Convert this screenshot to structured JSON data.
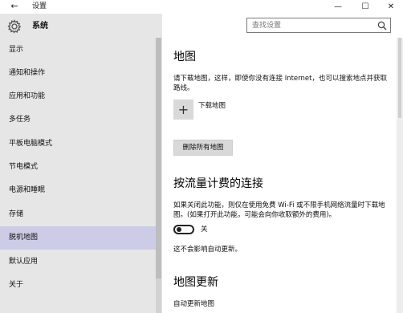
{
  "titlebar": {
    "title": "设置",
    "back_icon": "arrow-left-icon",
    "minimize_glyph": "—",
    "maximize_glyph": "☐",
    "close_glyph": "✕"
  },
  "sidebar": {
    "header": "系统",
    "header_icon": "gear-icon",
    "items": [
      {
        "label": "显示"
      },
      {
        "label": "通知和操作"
      },
      {
        "label": "应用和功能"
      },
      {
        "label": "多任务"
      },
      {
        "label": "平板电脑模式"
      },
      {
        "label": "节电模式"
      },
      {
        "label": "电源和睡眠"
      },
      {
        "label": "存储"
      },
      {
        "label": "脱机地图"
      },
      {
        "label": "默认应用"
      },
      {
        "label": "关于"
      }
    ],
    "selected_index": 8
  },
  "search": {
    "placeholder": "查找设置",
    "icon": "search-icon"
  },
  "main": {
    "maps": {
      "title": "地图",
      "description": "请下载地图，这样，即使你没有连接 Internet，也可以搜索地点并获取路线。",
      "download_label": "下载地图",
      "delete_all_button": "删除所有地图"
    },
    "metered": {
      "title": "按流量计费的连接",
      "description": "如果关闭此功能，则仅在使用免费 Wi-Fi 或不限手机网络流量时下载地图。(如果打开此功能，可能会向你收取额外的费用)。",
      "toggle_label": "关",
      "toggle_on": false,
      "note": "这不会影响自动更新。"
    },
    "updates": {
      "title": "地图更新",
      "auto_update_label": "自动更新地图"
    }
  },
  "colors": {
    "sidebar_bg": "#e6e6e6",
    "selected_bg": "#cccce6",
    "button_bg": "#d9d9d9"
  }
}
